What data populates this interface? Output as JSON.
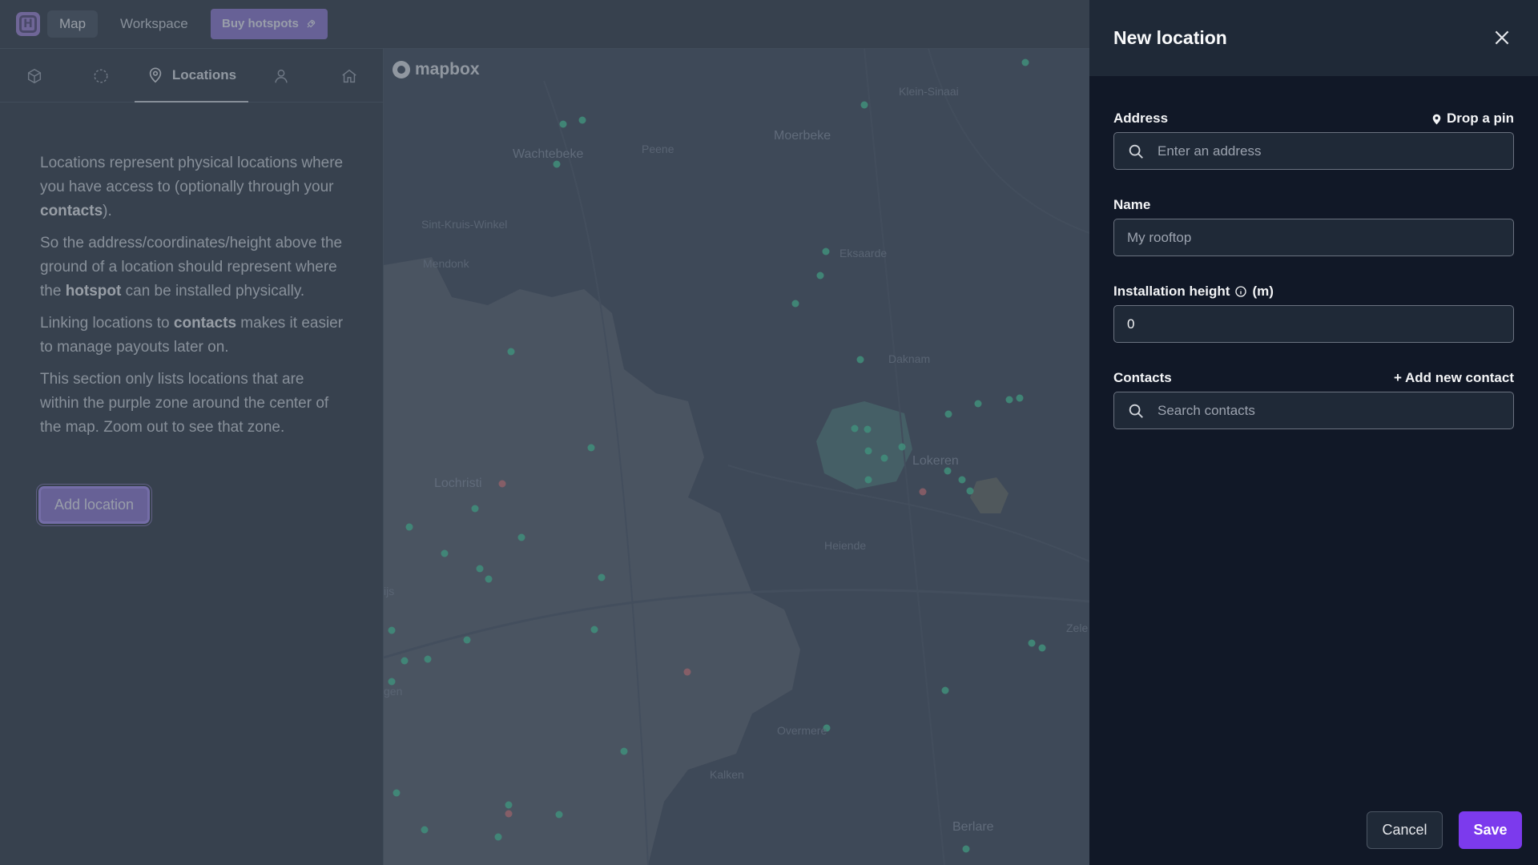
{
  "nav": {
    "logo_letter": "H",
    "map_label": "Map",
    "workspace_label": "Workspace",
    "buy_label": "Buy hotspots"
  },
  "sidebar": {
    "tabs": [
      {
        "icon": "cube-icon"
      },
      {
        "icon": "dashed-circle-icon"
      },
      {
        "icon": "map-pin-icon",
        "label": "Locations"
      },
      {
        "icon": "user-icon"
      },
      {
        "icon": "home-icon"
      }
    ],
    "p1_a": "Locations represent physical locations where you have access to (optionally through your ",
    "p1_b": "contacts",
    "p1_c": ").",
    "p2_a": "So the address/coordinates/height above the ground of a location should represent where the ",
    "p2_b": "hotspot",
    "p2_c": " can be installed physically.",
    "p3_a": "Linking locations to ",
    "p3_b": "contacts",
    "p3_c": " makes it easier to manage payouts later on.",
    "p4": "This section only lists locations that are within the purple zone around the center of the map. Zoom out to see that zone.",
    "add_location": "Add location"
  },
  "map": {
    "attribution": "mapbox",
    "labels": {
      "wachtebeke": "Wachtebeke",
      "moerbeke": "Moerbeke",
      "eksaarde": "Eksaarde",
      "daknam": "Daknam",
      "lokeren": "Lokeren",
      "lochristi": "Lochristi",
      "heiende": "Heiende",
      "overmere": "Overmere",
      "kalken": "Kalken",
      "berlare": "Berlare",
      "peene": "Peene",
      "sint_kruis": "Sint-Kruis-Winkel",
      "mendonk": "Mendonk",
      "klein_sinaai": "Klein-Sinaai",
      "zele": "Zele",
      "gen": "gen",
      "hijs": "ijs"
    }
  },
  "panel": {
    "title": "New location",
    "address_label": "Address",
    "drop_pin": "Drop a pin",
    "address_placeholder": "Enter an address",
    "name_label": "Name",
    "name_placeholder": "My rooftop",
    "height_label": "Installation height",
    "height_unit": "(m)",
    "height_value": "0",
    "contacts_label": "Contacts",
    "add_contact": "+ Add new contact",
    "contacts_placeholder": "Search contacts",
    "cancel": "Cancel",
    "save": "Save"
  },
  "colors": {
    "accent": "#7c3aed",
    "hotspot_green": "#34d399",
    "hotspot_red": "#f87171"
  }
}
